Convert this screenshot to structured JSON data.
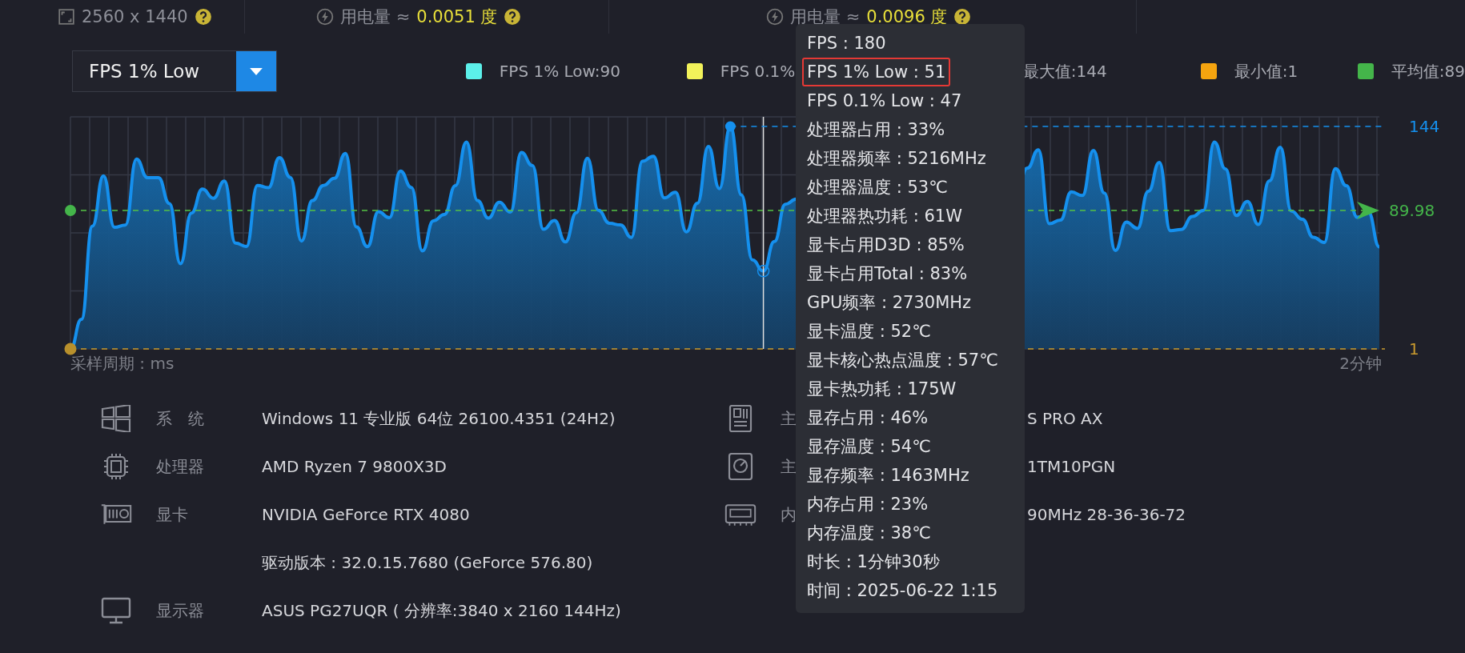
{
  "top_bar": [
    {
      "kind": "resolution",
      "label": "2560 x 1440",
      "help": true
    },
    {
      "kind": "power",
      "label": "用电量 ≈",
      "value": "0.0051 度",
      "help": true
    },
    {
      "kind": "power",
      "label": "用电量 ≈",
      "value": "0.0096 度",
      "help": true
    }
  ],
  "metric_select": {
    "value": "FPS 1% Low"
  },
  "legend": [
    {
      "label": "FPS 1% Low:90",
      "color": "#5cf0ea"
    },
    {
      "label": "FPS 0.1%",
      "color": "#f2f25a"
    },
    {
      "label": "最大值:144"
    },
    {
      "label": "最小值:1",
      "color": "#f5a40f"
    },
    {
      "label": "平均值:89",
      "color": "#44b54a"
    }
  ],
  "chart": {
    "max_label": "144",
    "average_label": "89.98",
    "min_label": "1",
    "x_start_label": "采样周期 : ms",
    "x_end_label": "2分钟"
  },
  "tooltip": [
    {
      "text": "FPS : 180",
      "highlighted": false
    },
    {
      "text": "FPS 1% Low : 51",
      "highlighted": true
    },
    {
      "text": "FPS 0.1% Low : 47",
      "highlighted": false
    },
    {
      "text": "处理器占用 : 33%",
      "highlighted": false
    },
    {
      "text": "处理器频率 : 5216MHz",
      "highlighted": false
    },
    {
      "text": "处理器温度 : 53℃",
      "highlighted": false
    },
    {
      "text": "处理器热功耗 : 61W",
      "highlighted": false
    },
    {
      "text": "显卡占用D3D : 85%",
      "highlighted": false
    },
    {
      "text": "显卡占用Total : 83%",
      "highlighted": false
    },
    {
      "text": "GPU频率 : 2730MHz",
      "highlighted": false
    },
    {
      "text": "显卡温度 : 52℃",
      "highlighted": false
    },
    {
      "text": "显卡核心热点温度 : 57℃",
      "highlighted": false
    },
    {
      "text": "显卡热功耗 : 175W",
      "highlighted": false
    },
    {
      "text": "显存占用 : 46%",
      "highlighted": false
    },
    {
      "text": "显存温度 : 54℃",
      "highlighted": false
    },
    {
      "text": "显存频率 : 1463MHz",
      "highlighted": false
    },
    {
      "text": "内存占用 : 23%",
      "highlighted": false
    },
    {
      "text": "内存温度 : 38℃",
      "highlighted": false
    },
    {
      "text": "时长 : 1分钟30秒",
      "highlighted": false
    },
    {
      "text": "时间 : 2025-06-22 1:15",
      "highlighted": false
    }
  ],
  "system_info_left": [
    {
      "kind": "os",
      "label": "系　统",
      "value": "Windows 11 专业版 64位 26100.4351 (24H2)"
    },
    {
      "kind": "cpu",
      "label": "处理器",
      "value": "AMD Ryzen 7 9800X3D"
    },
    {
      "kind": "gpu",
      "label": "显卡",
      "value": "NVIDIA GeForce RTX 4080"
    },
    {
      "kind": "detail",
      "value": "驱动版本 : 32.0.15.7680 (GeForce 576.80)"
    },
    {
      "kind": "monitor",
      "label": "显示器",
      "value": "ASUS PG27UQR ( 分辨率:3840 x 2160 144Hz)"
    }
  ],
  "system_info_right": [
    {
      "kind": "motherboard",
      "label": "主",
      "value": "S PRO AX"
    },
    {
      "kind": "disk",
      "label": "主",
      "value": "1TM10PGN"
    },
    {
      "kind": "ram",
      "label": "内",
      "value": "90MHz 28-36-36-72"
    }
  ]
}
